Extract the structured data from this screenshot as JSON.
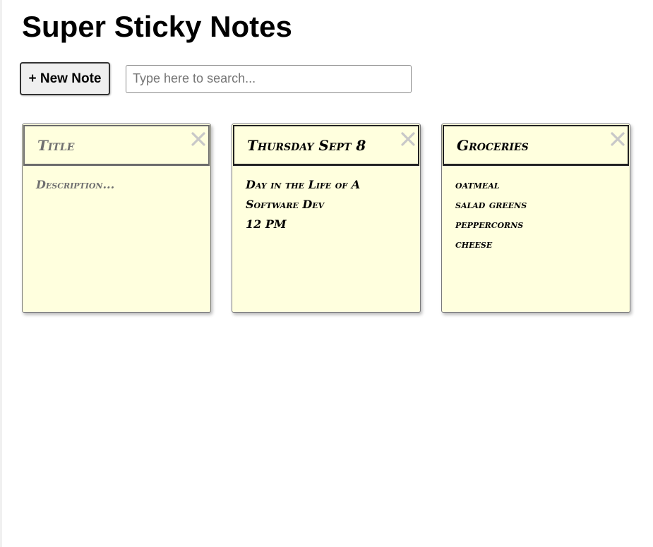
{
  "app": {
    "title": "Super Sticky Notes"
  },
  "toolbar": {
    "new_note_label": "+ New Note",
    "search_placeholder": "Type here to search..."
  },
  "notes": [
    {
      "title": "",
      "title_placeholder": "Title",
      "description_lines": [],
      "description_placeholder": "Description..."
    },
    {
      "title": "Thursday Sept 8",
      "title_placeholder": "Title",
      "description_lines": [
        "Day in the Life of A",
        "Software Dev",
        "12 PM"
      ],
      "description_placeholder": "Description..."
    },
    {
      "title": "Groceries",
      "title_placeholder": "Title",
      "description_lines": [
        "oatmeal",
        "salad greens",
        "peppercorns",
        "cheese"
      ],
      "description_placeholder": "Description..."
    }
  ],
  "icons": {
    "delete": "close-icon"
  },
  "colors": {
    "note_background": "#ffffde",
    "close_icon": "#c8c8c8",
    "placeholder_text": "#707070"
  }
}
